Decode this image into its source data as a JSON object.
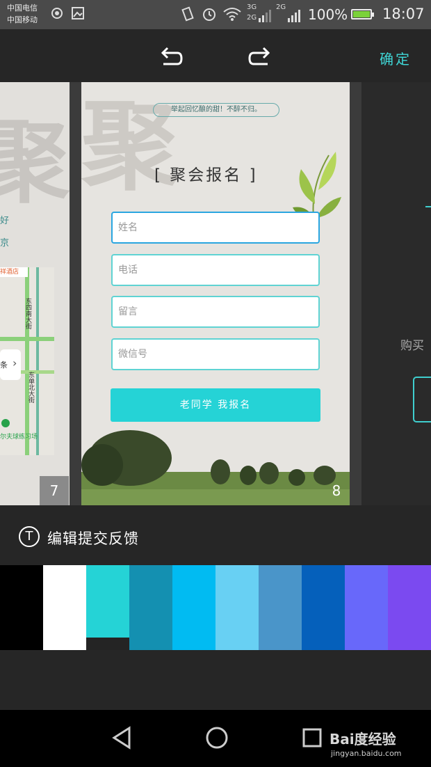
{
  "status_bar": {
    "carrier1": "中国电信",
    "carrier2": "中国移动",
    "network1": "3G",
    "network2": "2G",
    "network3": "2G",
    "battery": "100%",
    "time": "18:07"
  },
  "toolbar": {
    "undo_icon": "undo-arrow",
    "redo_icon": "redo-arrow",
    "confirm_label": "确定"
  },
  "pages": {
    "left": {
      "bg_char": "聚",
      "text1": "好",
      "text2": "京",
      "map_label_top": "祥酒店",
      "map_street1": "东四南大街",
      "map_street2": "东单北大街",
      "map_side": "条",
      "map_bottom": "尔夫球练习场",
      "page_number": "7"
    },
    "main": {
      "bg_char": "聚",
      "slogan": "举起回忆酿的甜！不醉不归。",
      "title": "[ 聚会报名 ]",
      "fields": [
        {
          "placeholder": "姓名"
        },
        {
          "placeholder": "电话"
        },
        {
          "placeholder": "留言"
        },
        {
          "placeholder": "微信号"
        }
      ],
      "submit_label": "老同学  我报名",
      "page_number": "8"
    },
    "right": {
      "buy_text": "购买"
    }
  },
  "edit": {
    "icon": "T",
    "label": "编辑提交反馈"
  },
  "palette": [
    "#000000",
    "#ffffff",
    "#25d3d6",
    "#1490b1",
    "#01bbf2",
    "#68d0f3",
    "#4a95c9",
    "#0560bb",
    "#6868fa",
    "#7b4af0"
  ],
  "nav": {
    "watermark": "Bai度经验",
    "watermark_url": "jingyan.baidu.com"
  }
}
